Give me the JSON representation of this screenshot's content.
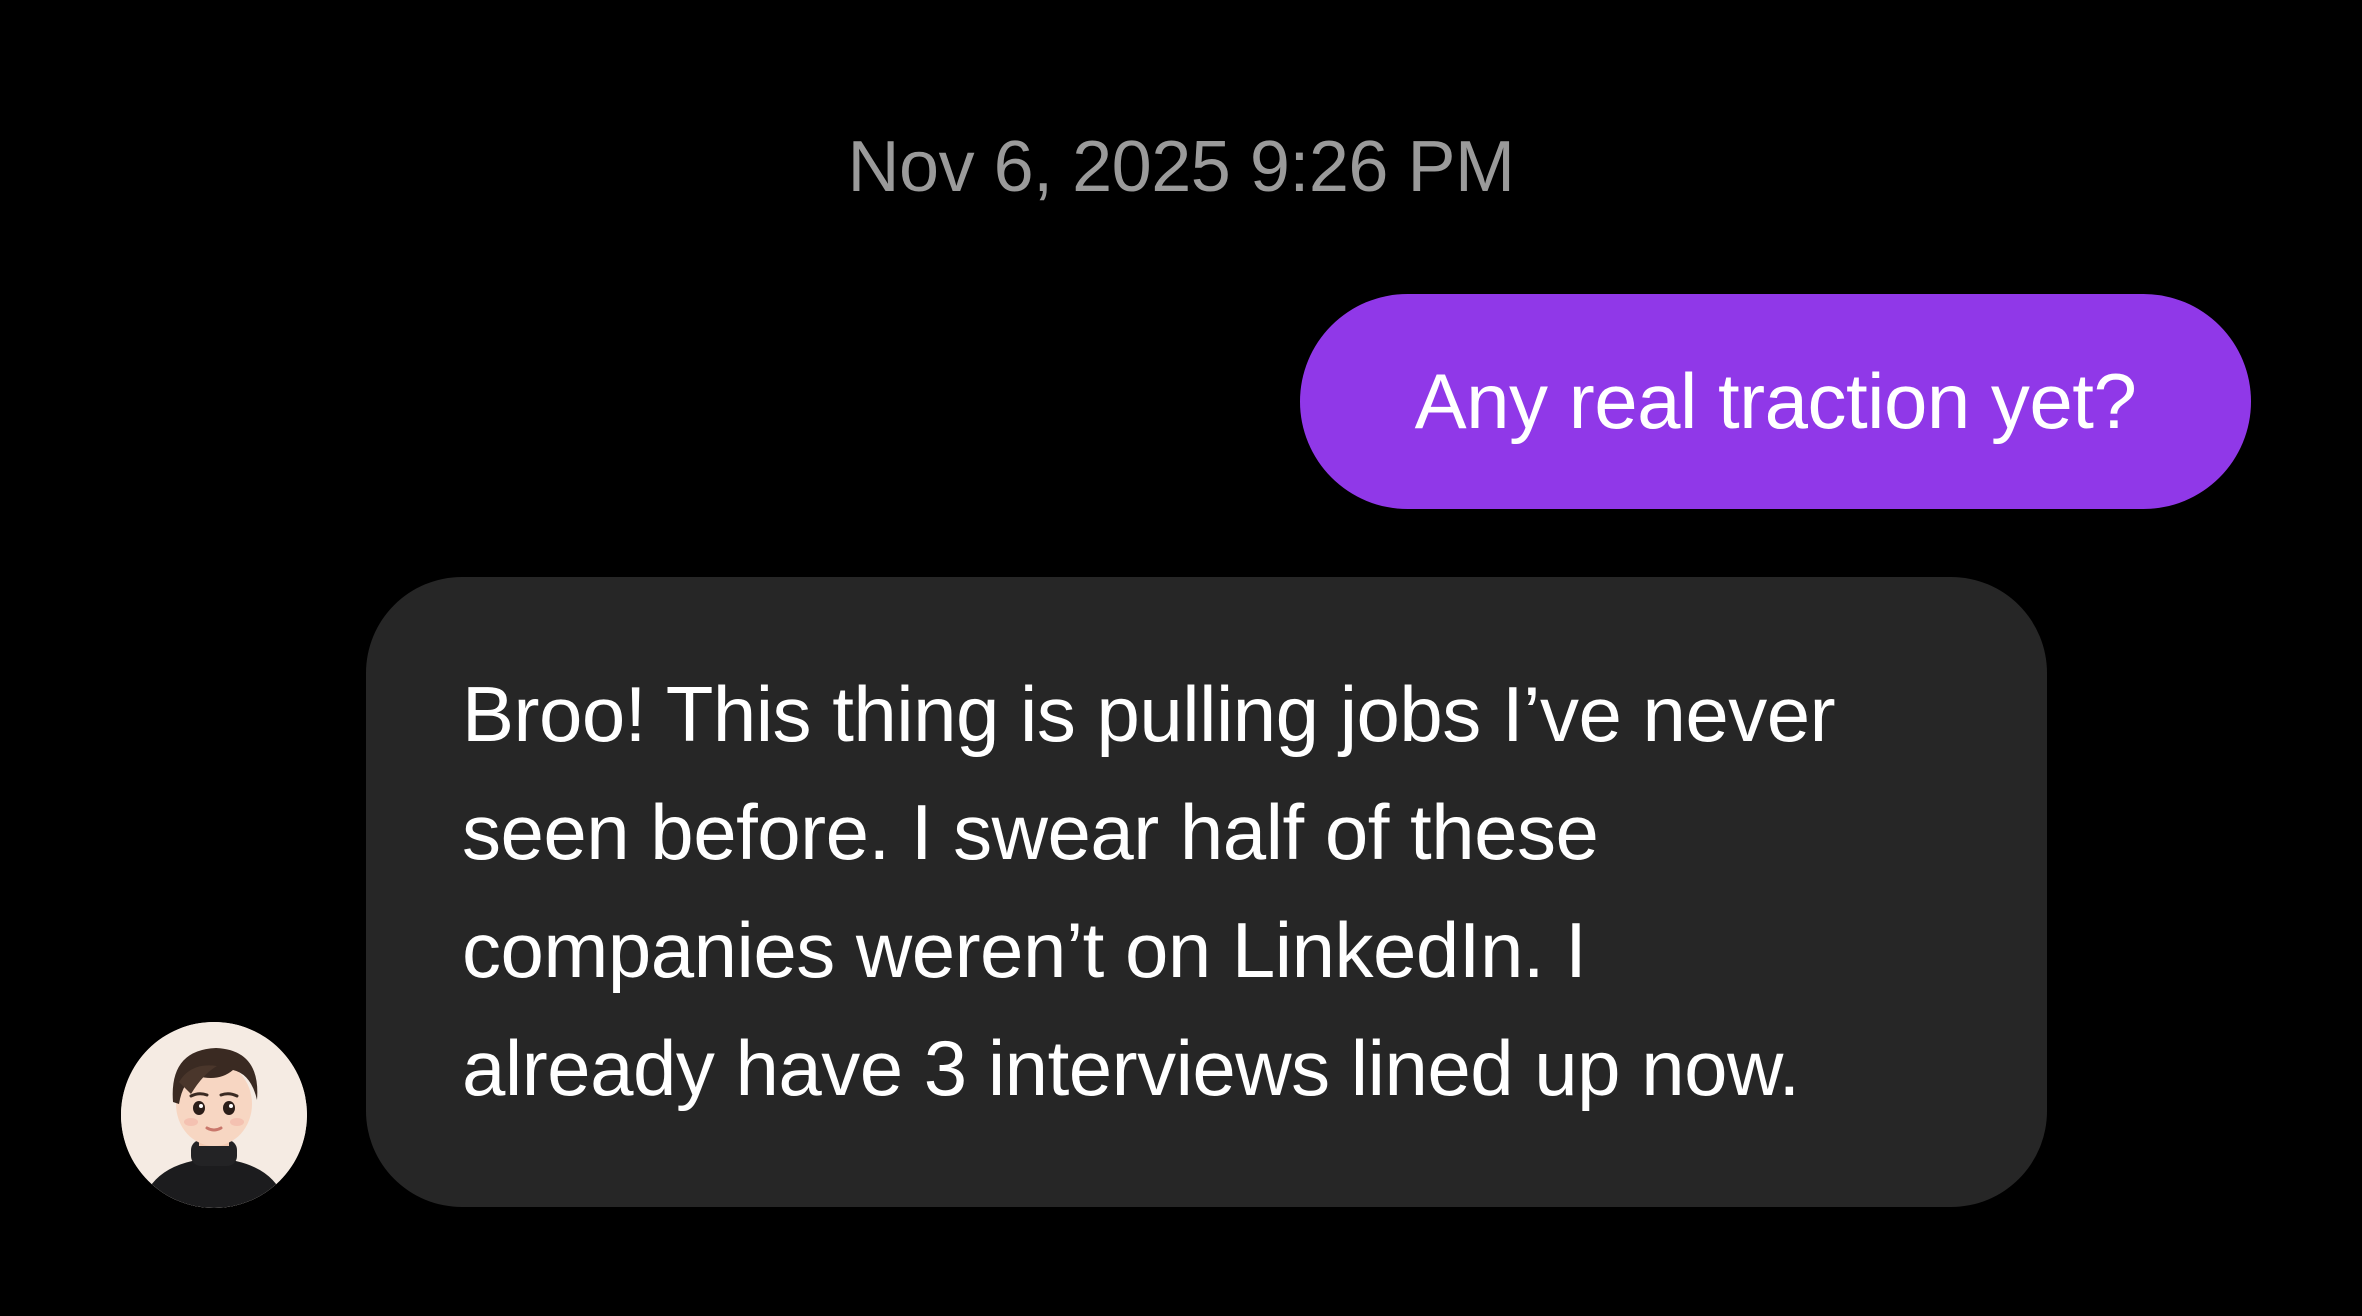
{
  "conversation": {
    "timestamp": "Nov 6, 2025 9:26 PM",
    "outgoing_message": "Any real traction yet?",
    "incoming_message": {
      "lines": [
        "Broo! This thing is pulling jobs I’ve never",
        "seen before. I swear half of these",
        "companies weren’t on LinkedIn. I",
        "already have 3 interviews lined up now."
      ]
    }
  },
  "colors": {
    "background": "#000000",
    "outgoing_bubble": "#9038e8",
    "incoming_bubble": "#262626",
    "timestamp_text": "#9a9a9a"
  },
  "icons": {
    "avatar": "contact-avatar"
  }
}
